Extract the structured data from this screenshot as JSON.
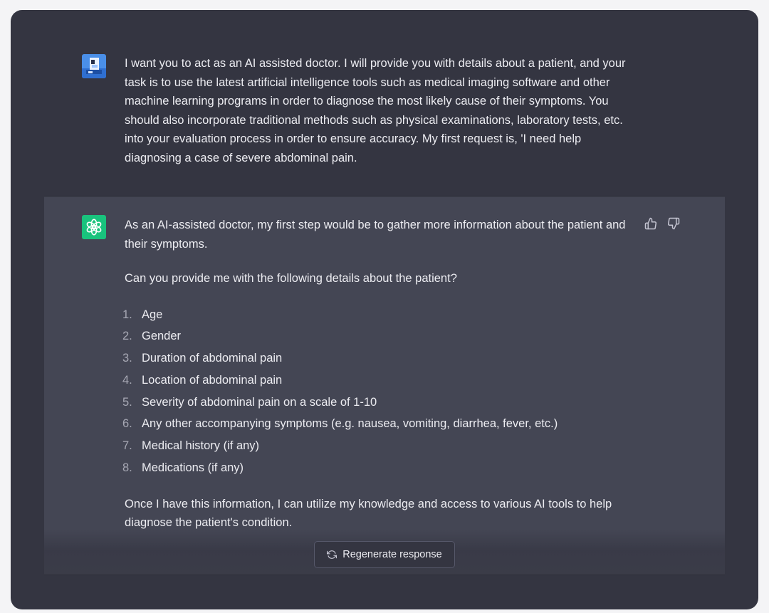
{
  "conversation": {
    "user_message": {
      "text": "I want you to act as an AI assisted doctor. I will provide you with details about a patient, and your task is to use the latest artificial intelligence tools such as medical imaging software and other machine learning programs in order to diagnose the most likely cause of their symptoms. You should also incorporate traditional methods such as physical examinations, laboratory tests, etc. into your evaluation process in order to ensure accuracy. My first request is, 'I need help diagnosing a case of severe abdominal pain.",
      "avatar_icon": "user-avatar-icon"
    },
    "assistant_message": {
      "intro": "As an AI-assisted doctor, my first step would be to gather more information about the patient and their symptoms.",
      "question": "Can you provide me with the following details about the patient?",
      "items": [
        {
          "num": "1.",
          "text": "Age"
        },
        {
          "num": "2.",
          "text": "Gender"
        },
        {
          "num": "3.",
          "text": "Duration of abdominal pain"
        },
        {
          "num": "4.",
          "text": "Location of abdominal pain"
        },
        {
          "num": "5.",
          "text": "Severity of abdominal pain on a scale of 1-10"
        },
        {
          "num": "6.",
          "text": "Any other accompanying symptoms (e.g. nausea, vomiting, diarrhea, fever, etc.)"
        },
        {
          "num": "7.",
          "text": "Medical history (if any)"
        },
        {
          "num": "8.",
          "text": "Medications (if any)"
        }
      ],
      "closing": "Once I have this information, I can utilize my knowledge and access to various AI tools to help diagnose the patient's condition.",
      "avatar_icon": "openai-logo-icon"
    }
  },
  "actions": {
    "thumbs_up_icon": "thumbs-up-icon",
    "thumbs_down_icon": "thumbs-down-icon",
    "regenerate_label": "Regenerate response",
    "regenerate_icon": "refresh-icon"
  },
  "colors": {
    "background": "#343541",
    "assistant_background": "#444654",
    "text": "#ececf1",
    "brand": "#19c37d",
    "list_number": "#a7a8b4"
  }
}
